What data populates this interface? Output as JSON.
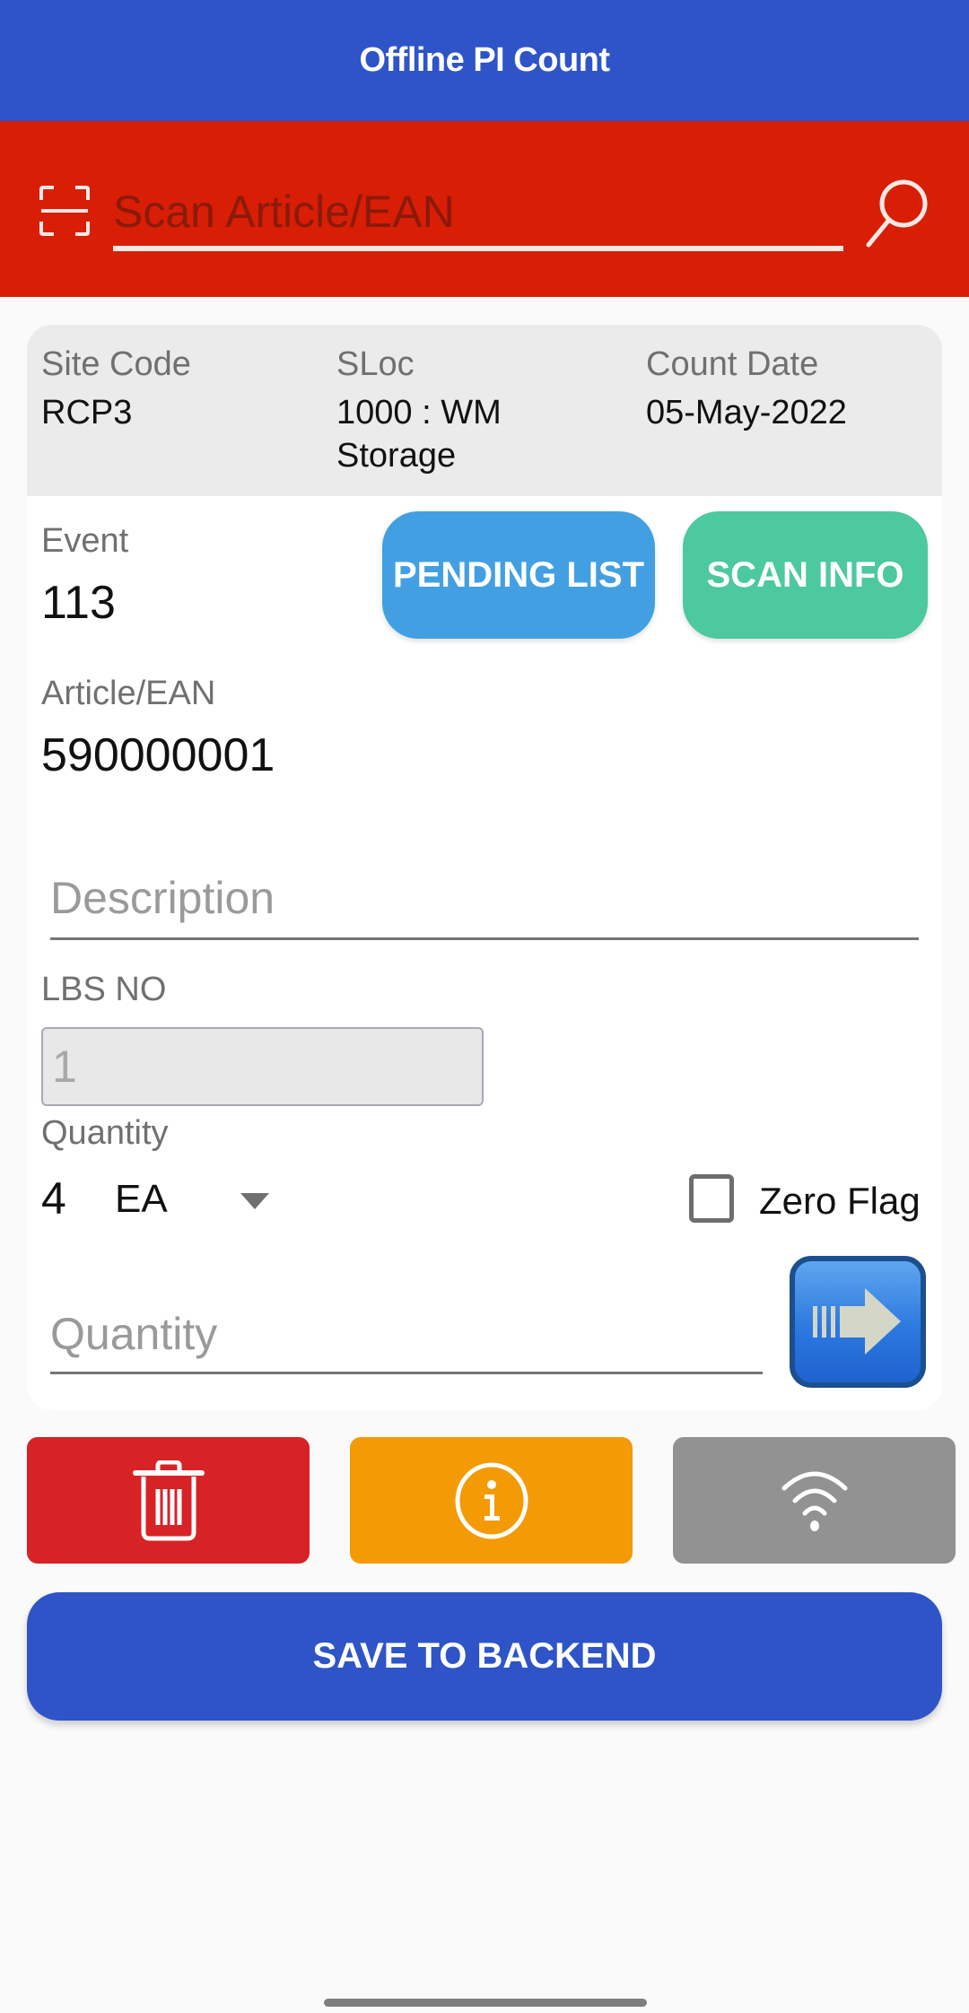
{
  "header": {
    "title": "Offline PI Count"
  },
  "scan": {
    "placeholder": "Scan Article/EAN",
    "value": ""
  },
  "info": {
    "site_code_label": "Site Code",
    "site_code": "RCP3",
    "sloc_label": "SLoc",
    "sloc_line1": "1000 : WM",
    "sloc_line2": "Storage",
    "count_date_label": "Count Date",
    "count_date": "05-May-2022"
  },
  "event": {
    "label": "Event",
    "value": "113"
  },
  "buttons": {
    "pending_list": "PENDING LIST",
    "scan_info": "SCAN INFO",
    "save": "SAVE TO BACKEND"
  },
  "article": {
    "label": "Article/EAN",
    "value": "590000001"
  },
  "description": {
    "placeholder": "Description",
    "value": ""
  },
  "lbs": {
    "label": "LBS NO",
    "value": "1"
  },
  "quantity": {
    "label": "Quantity",
    "current": "4",
    "unit": "EA",
    "zero_flag_label": "Zero Flag",
    "zero_flag_checked": false,
    "input_placeholder": "Quantity",
    "input_value": ""
  },
  "colors": {
    "header": "#2E54C8",
    "scan_bar": "#D81E05",
    "pending_list": "#42A0E2",
    "scan_info": "#4CC99E",
    "delete": "#D72226",
    "info": "#F39A05",
    "wifi": "#929292",
    "save": "#2E54C8"
  }
}
